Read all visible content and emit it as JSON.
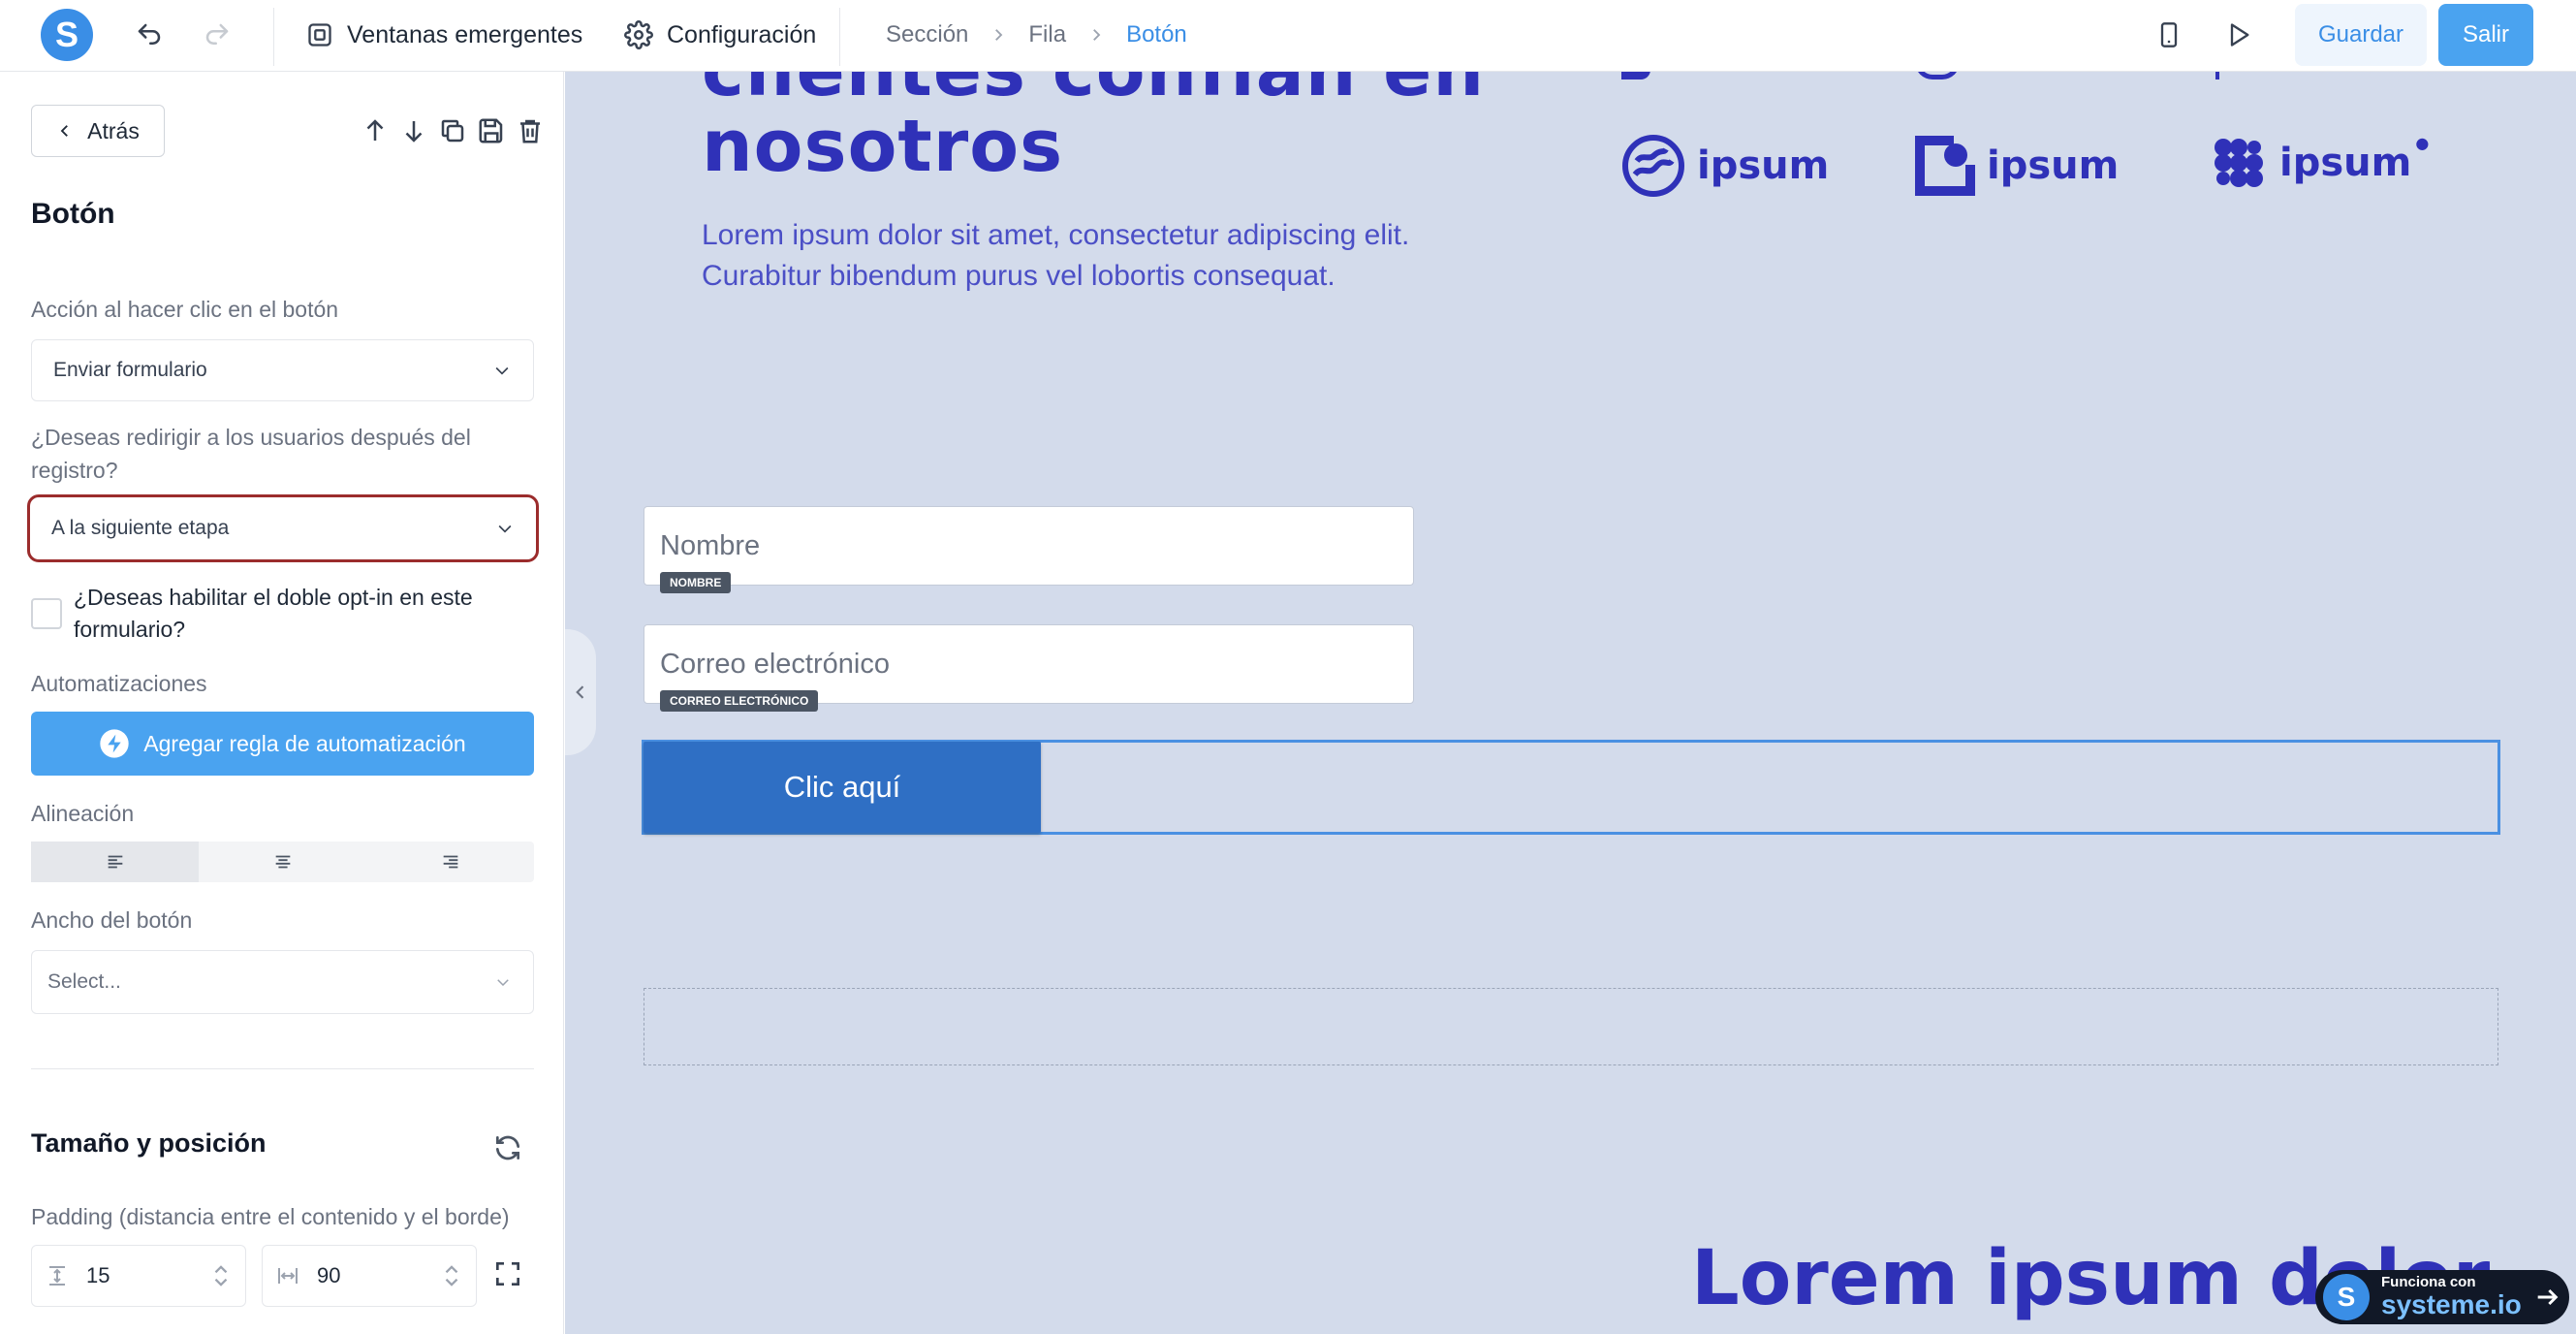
{
  "brand": {
    "logo_letter": "S",
    "accent": "#3a8ee6"
  },
  "topbar": {
    "popups_label": "Ventanas emergentes",
    "settings_label": "Configuración",
    "breadcrumb": [
      "Sección",
      "Fila",
      "Botón"
    ],
    "save_label": "Guardar",
    "exit_label": "Salir"
  },
  "sidebar": {
    "back_label": "Atrás",
    "title": "Botón",
    "click_action_label": "Acción al hacer clic en el botón",
    "click_action_value": "Enviar formulario",
    "redirect_label": "¿Deseas redirigir a los usuarios después del registro?",
    "redirect_value": "A la siguiente etapa",
    "double_optin_label": "¿Deseas habilitar el doble opt-in en este formulario?",
    "automations_label": "Automatizaciones",
    "add_rule_label": "Agregar regla de automatización",
    "alignment_label": "Alineación",
    "alignment_selected": "left",
    "width_label": "Ancho del botón",
    "width_placeholder": "Select...",
    "size_position_title": "Tamaño y posición",
    "padding_label": "Padding (distancia entre el contenido y el borde)",
    "padding_vertical": "15",
    "padding_horizontal": "90"
  },
  "canvas": {
    "hero_title_partial": "clientes confían en",
    "hero_title_line2": "nosotros",
    "hero_text_1": "Lorem ipsum dolor sit amet, consectetur adipiscing elit.",
    "hero_text_2": "Curabitur bibendum purus vel lobortis consequat.",
    "logos": [
      "ipsum",
      "ipsum",
      "ipsum"
    ],
    "name_placeholder": "Nombre",
    "name_tag": "NOMBRE",
    "email_placeholder": "Correo electrónico",
    "email_tag": "CORREO ELECTRÓNICO",
    "cta_label": "Clic aquí",
    "bottom_title": "Lorem ipsum dolor",
    "badge_small": "Funciona con",
    "badge_brand": "systeme.io"
  }
}
